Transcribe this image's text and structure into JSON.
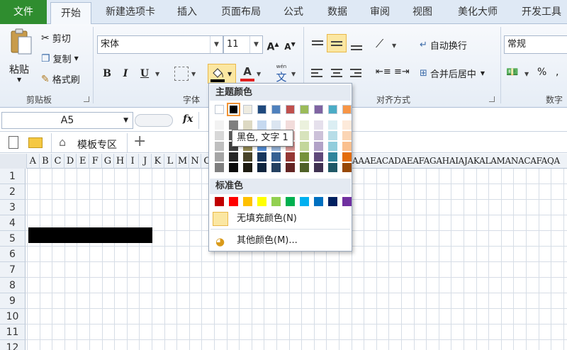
{
  "tabs": [
    "文件",
    "开始",
    "新建选项卡",
    "插入",
    "页面布局",
    "公式",
    "数据",
    "审阅",
    "视图",
    "美化大师",
    "开发工具"
  ],
  "clipboard": {
    "paste": "粘贴",
    "cut": "剪切",
    "copy": "复制",
    "format_painter": "格式刷",
    "group": "剪贴板"
  },
  "font": {
    "name": "宋体",
    "size": "11",
    "group": "字体",
    "bold": "B",
    "italic": "I",
    "underline": "U",
    "grow": "A",
    "shrink": "A",
    "fill_label": "A",
    "phonetic": "wén",
    "phonetic_char": "文"
  },
  "align": {
    "wrap": "自动换行",
    "merge": "合并后居中",
    "group": "对齐方式"
  },
  "number": {
    "format": "常规",
    "percent": "%",
    "group": "数字"
  },
  "formula_bar": {
    "name_box": "A5",
    "fx": "fx"
  },
  "sheet_tabs": {
    "template": "模板专区",
    "add": "+"
  },
  "columns": [
    "A",
    "B",
    "C",
    "D",
    "E",
    "F",
    "G",
    "H",
    "I",
    "J",
    "K",
    "L",
    "M",
    "N",
    "O"
  ],
  "columns_right": "AAAEACADAEAFAGAHAIAJAKALAMANACAFAQA",
  "rows": [
    "1",
    "2",
    "3",
    "4",
    "5",
    "6",
    "7",
    "8",
    "9",
    "10",
    "11",
    "12"
  ],
  "popup": {
    "theme_title": "主题颜色",
    "theme_top": [
      "#ffffff",
      "#000000",
      "#eeece1",
      "#1f497d",
      "#4f81bd",
      "#c0504d",
      "#9bbb59",
      "#8064a2",
      "#4bacc6",
      "#f79646"
    ],
    "theme_shades": [
      [
        "#f2f2f2",
        "#d8d8d8",
        "#bfbfbf",
        "#a5a5a5",
        "#7f7f7f"
      ],
      [
        "#7f7f7f",
        "#595959",
        "#3f3f3f",
        "#262626",
        "#0c0c0c"
      ],
      [
        "#ddd9c3",
        "#c4bd97",
        "#938953",
        "#494429",
        "#1d1b10"
      ],
      [
        "#c6d9f0",
        "#8db3e2",
        "#548dd4",
        "#17365d",
        "#0f243e"
      ],
      [
        "#dbe5f1",
        "#b8cce4",
        "#95b3d7",
        "#366092",
        "#244061"
      ],
      [
        "#f2dcdb",
        "#e5b9b7",
        "#d99694",
        "#953734",
        "#632423"
      ],
      [
        "#ebf1dd",
        "#d7e3bc",
        "#c3d69b",
        "#76923c",
        "#4f6128"
      ],
      [
        "#e5e0ec",
        "#ccc1d9",
        "#b2a2c7",
        "#5f497a",
        "#3f3151"
      ],
      [
        "#dbeef3",
        "#b7dde8",
        "#92cddc",
        "#31859b",
        "#205867"
      ],
      [
        "#fdeada",
        "#fbd5b5",
        "#fac08f",
        "#e36c09",
        "#974806"
      ]
    ],
    "standard_title": "标准色",
    "standard": [
      "#c00000",
      "#ff0000",
      "#ffc000",
      "#ffff00",
      "#92d050",
      "#00b050",
      "#00b0f0",
      "#0070c0",
      "#002060",
      "#7030a0"
    ],
    "no_fill": "无填充颜色(N)",
    "more_colors": "其他颜色(M)..."
  },
  "tooltip": "黑色, 文字 1",
  "colors": {
    "file_tab": "#2f8d2f",
    "fill_black": "#000000",
    "highlight": "#fbe7a2"
  }
}
